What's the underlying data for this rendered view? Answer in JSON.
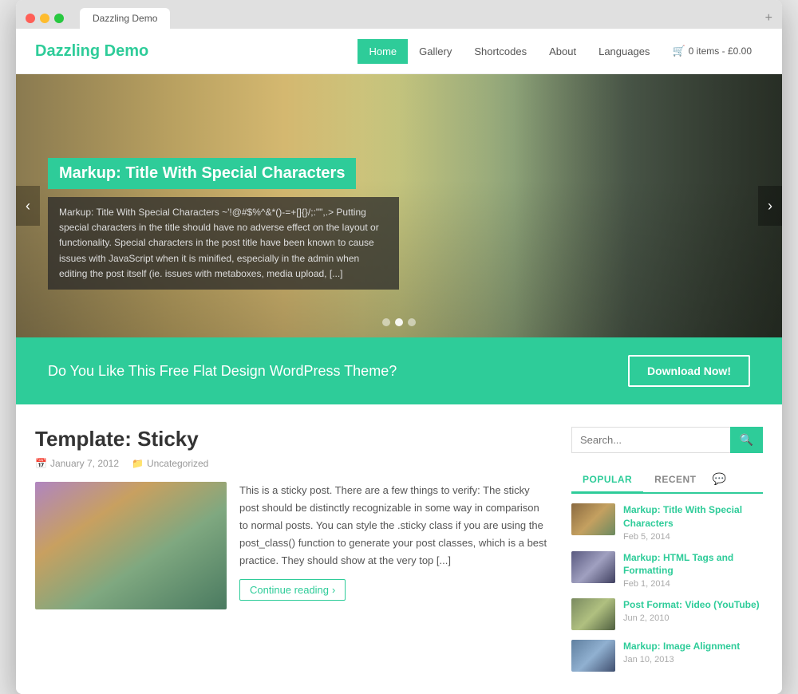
{
  "browser": {
    "tab_label": "Dazzling Demo",
    "plus_label": "+"
  },
  "header": {
    "logo": "Dazzling Demo",
    "nav": [
      {
        "label": "Home",
        "active": true
      },
      {
        "label": "Gallery",
        "active": false
      },
      {
        "label": "Shortcodes",
        "active": false
      },
      {
        "label": "About",
        "active": false,
        "dropdown": true
      },
      {
        "label": "Languages",
        "active": false
      },
      {
        "label": "0 items - £0.00",
        "active": false,
        "cart": true
      }
    ]
  },
  "hero": {
    "title": "Markup: Title With Special Characters",
    "description": "Markup: Title With Special Characters ~'!@#$%^&*()-=+[]{}/;:\"\",.> Putting special characters in the title should have no adverse effect on the layout or functionality. Special characters in the post title have been known to cause issues with JavaScript when it is minified, especially in the admin when editing the post itself (ie. issues with metaboxes, media upload, [...]",
    "arrow_left": "‹",
    "arrow_right": "›",
    "dots": [
      {
        "active": false
      },
      {
        "active": true
      },
      {
        "active": false
      }
    ]
  },
  "cta": {
    "text": "Do You Like This Free Flat Design WordPress Theme?",
    "button_label": "Download Now!"
  },
  "post": {
    "title": "Template: Sticky",
    "date": "January 7, 2012",
    "category": "Uncategorized",
    "calendar_icon": "📅",
    "folder_icon": "📁",
    "body": "This is a sticky post. There are a few things to verify: The sticky post should be distinctly recognizable in some way in comparison to normal posts. You can style the .sticky class if you are using the post_class() function to generate your post classes, which is a best practice. They should show at the very top [...]",
    "continue_label": "Continue reading"
  },
  "sidebar": {
    "search_placeholder": "Search...",
    "search_icon": "🔍",
    "tabs": [
      {
        "label": "POPULAR",
        "active": true
      },
      {
        "label": "RECENT",
        "active": false
      }
    ],
    "comment_icon": "💬",
    "posts": [
      {
        "title": "Markup: Title With Special Characters",
        "date": "Feb 5, 2014",
        "thumb_class": "thumb-1"
      },
      {
        "title": "Markup: HTML Tags and Formatting",
        "date": "Feb 1, 2014",
        "thumb_class": "thumb-2"
      },
      {
        "title": "Post Format: Video (YouTube)",
        "date": "Jun 2, 2010",
        "thumb_class": "thumb-3"
      },
      {
        "title": "Markup: Image Alignment",
        "date": "Jan 10, 2013",
        "thumb_class": "thumb-4"
      }
    ]
  },
  "colors": {
    "accent": "#2ecc99",
    "text_dark": "#333",
    "text_muted": "#999"
  }
}
